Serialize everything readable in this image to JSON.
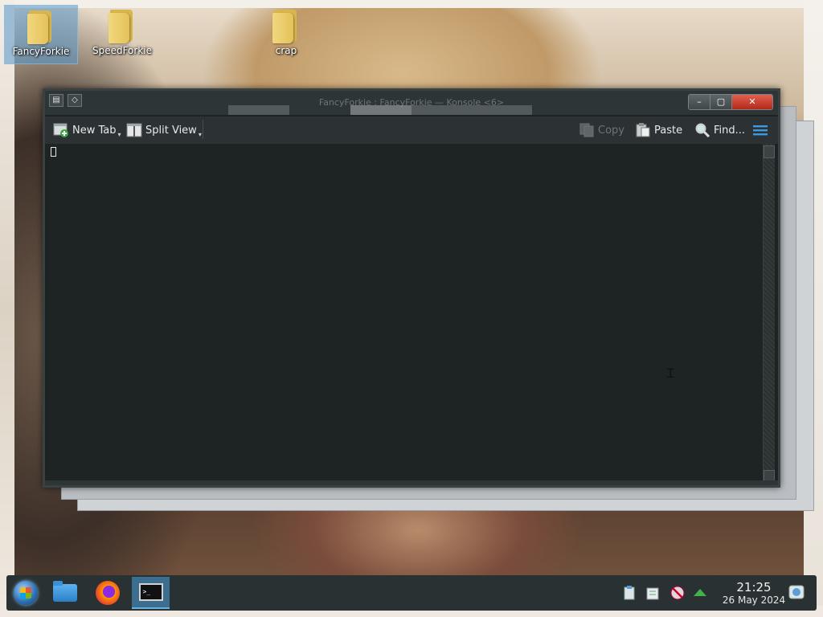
{
  "desktop": {
    "icons": [
      {
        "label": "FancyForkie",
        "selected": true
      },
      {
        "label": "SpeedForkie",
        "selected": false
      },
      {
        "label": "crap",
        "selected": false
      }
    ]
  },
  "konsole": {
    "title": "FancyForkie : FancyForkie — Konsole <6>",
    "toolbar": {
      "new_tab": "New Tab",
      "split_view": "Split View",
      "copy": "Copy",
      "paste": "Paste",
      "find": "Find..."
    }
  },
  "taskbar": {
    "clock_time": "21:25",
    "clock_date": "26 May 2024",
    "konsole_icon_text": ">_"
  },
  "colors": {
    "terminal_bg": "#1e2423",
    "toolbar_bg": "#2c3233",
    "taskbar_bg": "#2a3132",
    "active_task": "#3c6f8f"
  }
}
